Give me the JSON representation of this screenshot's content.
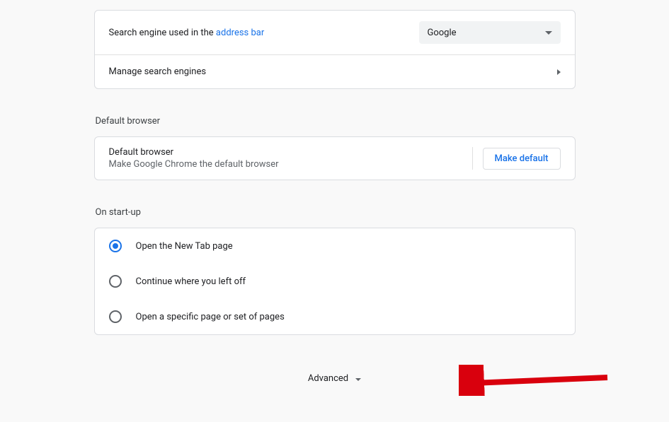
{
  "search": {
    "label_prefix": "Search engine used in the ",
    "link": "address bar",
    "selected": "Google",
    "manage_label": "Manage search engines"
  },
  "default_browser": {
    "section": "Default browser",
    "title": "Default browser",
    "desc": "Make Google Chrome the default browser",
    "button": "Make default"
  },
  "startup": {
    "section": "On start-up",
    "options": [
      "Open the New Tab page",
      "Continue where you left off",
      "Open a specific page or set of pages"
    ]
  },
  "advanced": {
    "label": "Advanced"
  }
}
